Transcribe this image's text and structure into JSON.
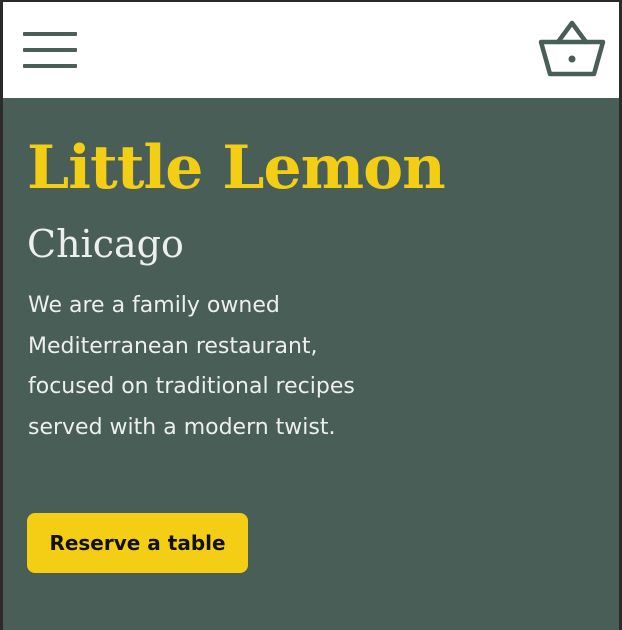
{
  "header": {
    "menu_icon": "hamburger-menu-icon",
    "basket_icon": "basket-icon"
  },
  "hero": {
    "title": "Little Lemon",
    "subtitle": "Chicago",
    "description": "We are a family owned Mediterranean restaurant, focused on traditional recipes served with a modern twist.",
    "cta_label": "Reserve a table"
  },
  "colors": {
    "primary_green": "#495e57",
    "primary_yellow": "#f4ce14",
    "light_text": "#edefee",
    "header_bg": "#ffffff"
  }
}
